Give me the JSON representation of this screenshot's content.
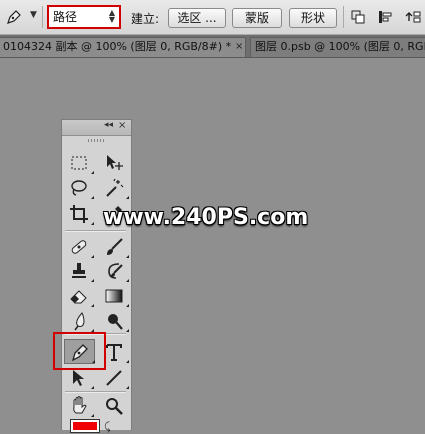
{
  "options_bar": {
    "mode_value": "路径",
    "create_label": "建立:",
    "selection_button": "选区 ...",
    "mask_button": "蒙版",
    "shape_button": "形状",
    "path_ops_icon": "path-operations-icon",
    "path_align_icon": "path-alignment-icon",
    "path_arrange_icon": "path-arrangement-icon"
  },
  "tabs": [
    {
      "label": "0104324 副本 @ 100% (图层 0, RGB/8#) *",
      "close": "×"
    },
    {
      "label": "图层 0.psb @ 100% (图层 0, RGB/8)",
      "close": ""
    }
  ],
  "toolbox": {
    "collapse": "◂◂",
    "close": "×",
    "tools": [
      [
        "rectangular-marquee-tool",
        "move-tool"
      ],
      [
        "lasso-tool",
        "magic-wand-tool"
      ],
      [
        "crop-tool",
        "eyedropper-tool"
      ],
      [
        "spot-healing-brush-tool",
        "brush-tool"
      ],
      [
        "clone-stamp-tool",
        "history-brush-tool"
      ],
      [
        "eraser-tool",
        "gradient-tool"
      ],
      [
        "blur-tool",
        "dodge-tool"
      ],
      [
        "pen-tool",
        "horizontal-type-tool"
      ],
      [
        "path-selection-tool",
        "line-tool"
      ],
      [
        "hand-tool",
        "zoom-tool"
      ]
    ],
    "active_tool": "pen-tool",
    "foreground_color": "#f00000",
    "swap_glyph": "⤹"
  },
  "watermark": "www.240PS.com",
  "colors": {
    "highlight": "#d20000",
    "canvas": "#8f8f8f"
  }
}
